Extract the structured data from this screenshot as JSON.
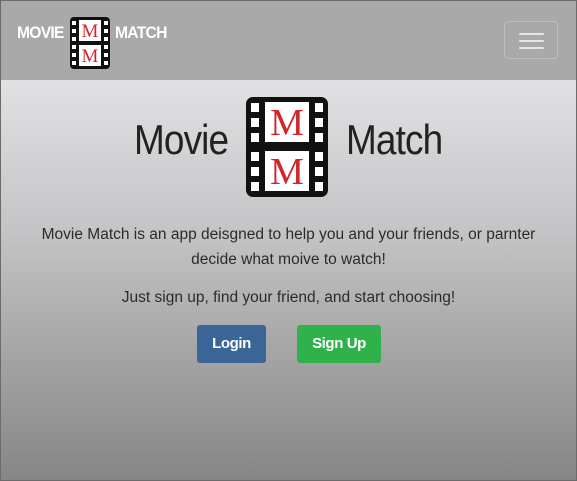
{
  "navbar": {
    "brand_left": "MOVIE",
    "brand_right": "MATCH",
    "logo_letter_top": "M",
    "logo_letter_bottom": "M",
    "menu_icon": "hamburger-menu-icon"
  },
  "hero": {
    "title_left": "Movie",
    "title_right": "Match",
    "logo_letter_top": "M",
    "logo_letter_bottom": "M",
    "description": "Movie Match is an app deisgned to help you and your friends, or parnter decide what moive to watch!",
    "tagline": "Just sign up, find your friend, and start choosing!",
    "login_label": "Login",
    "signup_label": "Sign Up"
  },
  "colors": {
    "navbar_bg": "#a9a9a9",
    "login_button": "#3a6697",
    "signup_button": "#2fb14c",
    "logo_letter": "#d0262b"
  }
}
